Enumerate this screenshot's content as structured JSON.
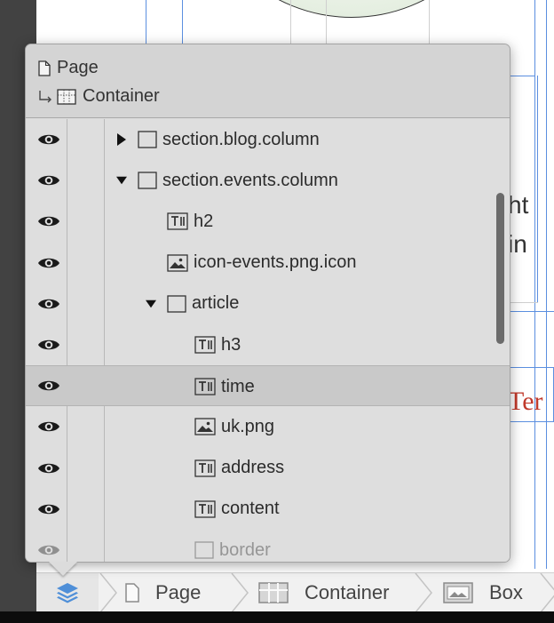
{
  "popover": {
    "header": {
      "page_label": "Page",
      "container_label": "Container",
      "page_icon": "page-icon",
      "container_icon": "container-icon",
      "child_arrow_icon": "child-arrow-icon"
    },
    "layers": [
      {
        "label": "section.blog.column",
        "type": "box",
        "depth": 0,
        "expand": "collapsed"
      },
      {
        "label": "section.events.column",
        "type": "box",
        "depth": 0,
        "expand": "expanded"
      },
      {
        "label": "h2",
        "type": "text",
        "depth": 1,
        "expand": "none"
      },
      {
        "label": "icon-events.png.icon",
        "type": "image",
        "depth": 1,
        "expand": "none"
      },
      {
        "label": "article",
        "type": "box",
        "depth": 1,
        "expand": "expanded"
      },
      {
        "label": "h3",
        "type": "text",
        "depth": 2,
        "expand": "none"
      },
      {
        "label": "time",
        "type": "text",
        "depth": 2,
        "expand": "none",
        "selected": true
      },
      {
        "label": "uk.png",
        "type": "image",
        "depth": 2,
        "expand": "none"
      },
      {
        "label": "address",
        "type": "text",
        "depth": 2,
        "expand": "none"
      },
      {
        "label": "content",
        "type": "text",
        "depth": 2,
        "expand": "none"
      },
      {
        "label": "border",
        "type": "box",
        "depth": 2,
        "expand": "none",
        "partial": true
      }
    ],
    "visibility_icon": "eye-icon"
  },
  "canvas": {
    "text_fragments": [
      "ht",
      "in",
      "Ter"
    ],
    "accent_color": "#c0392b",
    "guide_color": "#5b8fe0"
  },
  "breadcrumb": {
    "layers_icon": "layers-icon",
    "items": [
      {
        "label": "Page",
        "icon": "page-icon"
      },
      {
        "label": "Container",
        "icon": "container-icon"
      },
      {
        "label": "Box",
        "icon": "box-image-icon"
      }
    ]
  }
}
